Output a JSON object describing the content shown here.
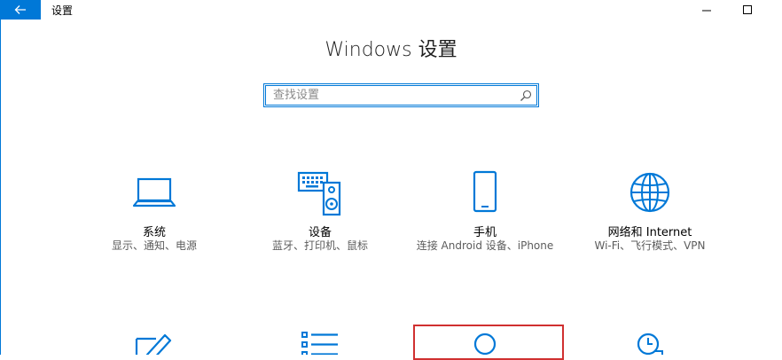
{
  "window": {
    "title": "设置",
    "back_icon": "arrow-left-icon",
    "minimize_icon": "minimize-icon",
    "maximize_icon": "maximize-icon",
    "accent_color": "#0078d7"
  },
  "page": {
    "title": "Windows 设置"
  },
  "search": {
    "placeholder": "查找设置",
    "value": "",
    "icon": "search-icon"
  },
  "tiles": [
    {
      "name": "系统",
      "desc": "显示、通知、电源",
      "icon": "laptop-icon"
    },
    {
      "name": "设备",
      "desc": "蓝牙、打印机、鼠标",
      "icon": "keyboard-speaker-icon"
    },
    {
      "name": "手机",
      "desc": "连接 Android 设备、iPhone",
      "icon": "phone-icon"
    },
    {
      "name": "网络和 Internet",
      "desc": "Wi-Fi、飞行模式、VPN",
      "icon": "globe-icon"
    },
    {
      "name": "",
      "desc": "",
      "icon": "personalization-icon"
    },
    {
      "name": "",
      "desc": "",
      "icon": "apps-list-icon"
    },
    {
      "name": "",
      "desc": "",
      "icon": "accounts-icon"
    },
    {
      "name": "",
      "desc": "",
      "icon": "time-language-icon"
    }
  ],
  "highlight_color": "#d03030"
}
